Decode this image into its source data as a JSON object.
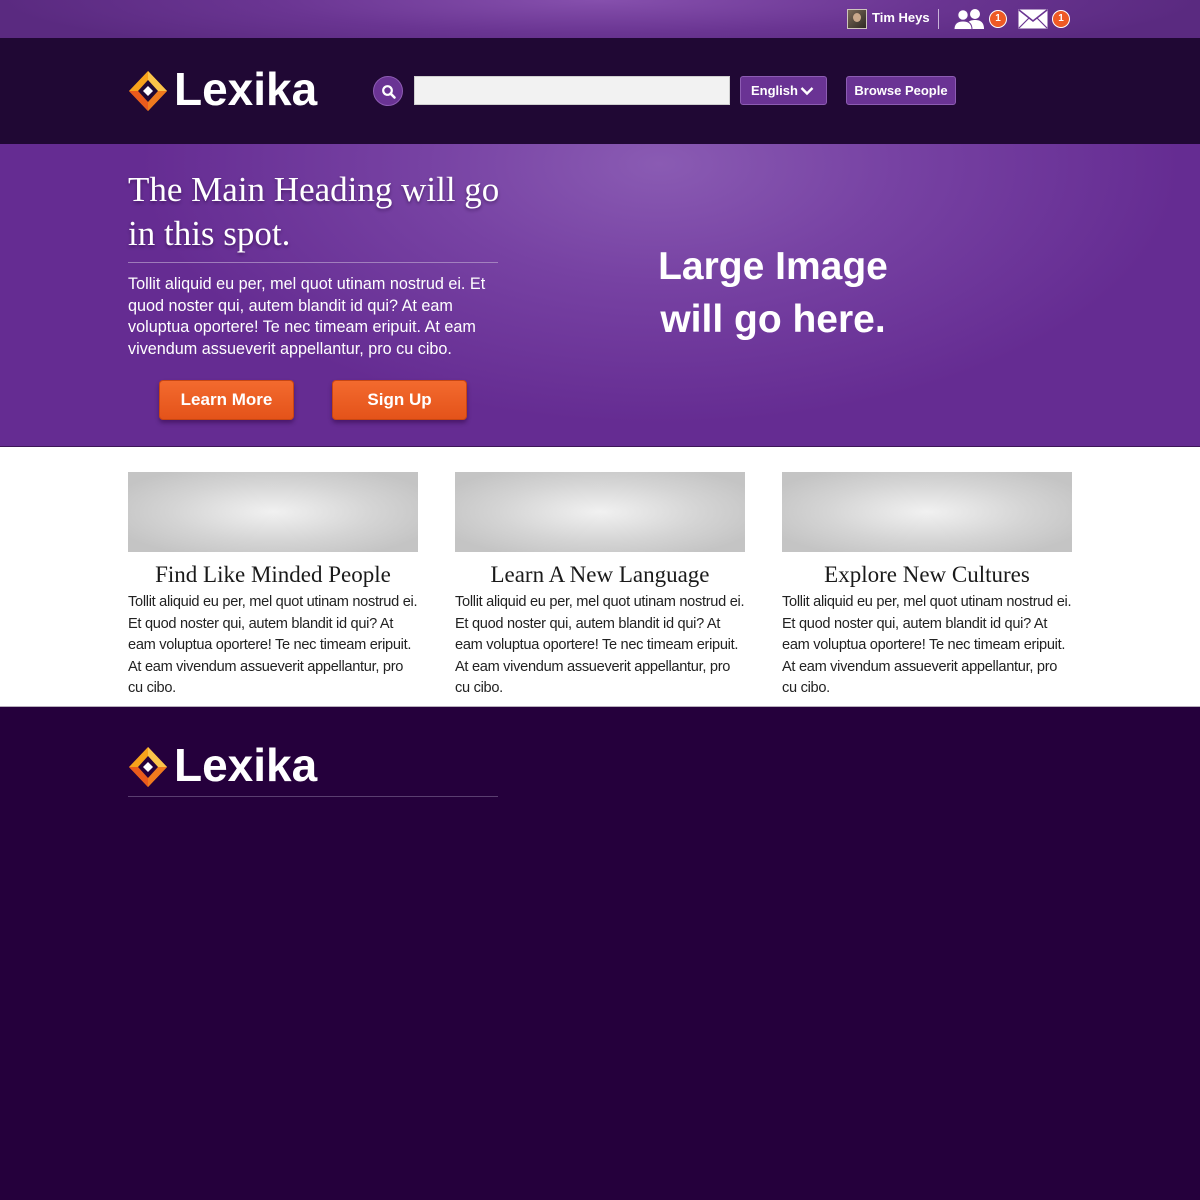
{
  "user_bar": {
    "username": "Tim Heys",
    "friend_requests_count": "1",
    "messages_count": "1",
    "icons": [
      "avatar",
      "friends-icon",
      "mail-icon"
    ]
  },
  "header": {
    "logo_text": "Lexika",
    "search_placeholder": "",
    "search_value": "",
    "language_label": "English",
    "browse_people_label": "Browse People"
  },
  "hero": {
    "heading": "The Main Heading will go in this spot.",
    "body": "Tollit aliquid eu per, mel quot utinam nostrud ei. Et quod noster qui, autem blandit id qui? At eam voluptua oportere! Te nec timeam eripuit. At eam vivendum assueverit appellantur, pro cu cibo.",
    "learn_more_label": "Learn More",
    "sign_up_label": "Sign Up",
    "image_placeholder_line1": "Large Image",
    "image_placeholder_line2": "will go here."
  },
  "features": [
    {
      "title": "Find Like Minded People",
      "body": "Tollit aliquid eu per, mel quot utinam nostrud ei. Et quod noster qui, autem blandit id qui? At eam voluptua oportere! Te nec timeam eripuit. At eam vivendum assueverit appellantur, pro cu cibo."
    },
    {
      "title": "Learn A New Language",
      "body": "Tollit aliquid eu per, mel quot utinam nostrud ei. Et quod noster qui, autem blandit id qui? At eam voluptua oportere! Te nec timeam eripuit. At eam vivendum assueverit appellantur, pro cu cibo."
    },
    {
      "title": "Explore New Cultures",
      "body": "Tollit aliquid eu per, mel quot utinam nostrud ei. Et quod noster qui, autem blandit id qui? At eam voluptua oportere! Te nec timeam eripuit. At eam vivendum assueverit appellantur, pro cu cibo."
    }
  ],
  "footer": {
    "logo_text": "Lexika"
  },
  "colors": {
    "brand_purple": "#6a3394",
    "dark_purple": "#25003c",
    "accent_orange": "#ee5a24",
    "logo_gold": "#f5a623"
  }
}
